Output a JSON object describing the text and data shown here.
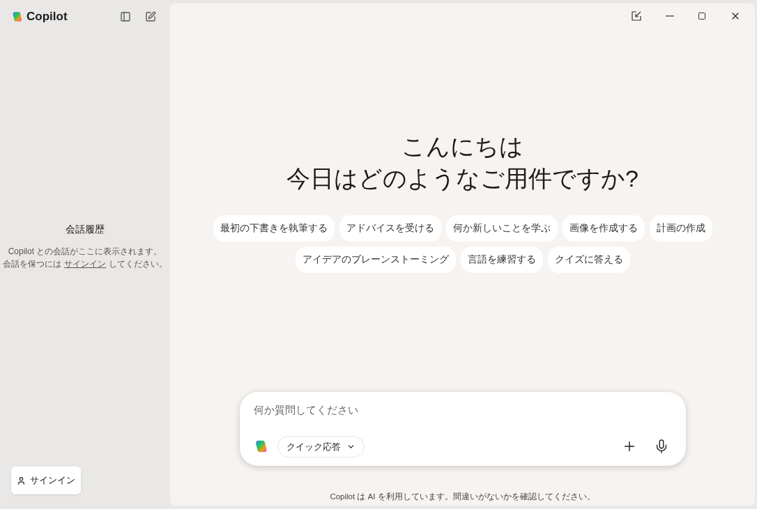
{
  "app": {
    "name": "Copilot"
  },
  "history": {
    "title": "会話履歴",
    "line_1": "Copilot との会話がここに表示されます。",
    "line_2_before": "会話を保つには",
    "line_2_link": "サインイン",
    "line_2_after": "してください。"
  },
  "sign_in_button": "サインイン",
  "greeting": {
    "line_1": "こんにちは",
    "line_2": "今日はどのようなご用件ですか?"
  },
  "suggestion_rows": [
    [
      "最初の下書きを執筆する",
      "アドバイスを受ける",
      "何か新しいことを学ぶ",
      "画像を作成する",
      "計画の作成"
    ],
    [
      "アイデアのブレーンストーミング",
      "言語を練習する",
      "クイズに答える"
    ]
  ],
  "composer": {
    "placeholder": "何か質問してください",
    "mode": "クイック応答"
  },
  "disclaimer": "Copilot は AI を利用しています。間違いがないかを確認してください。"
}
